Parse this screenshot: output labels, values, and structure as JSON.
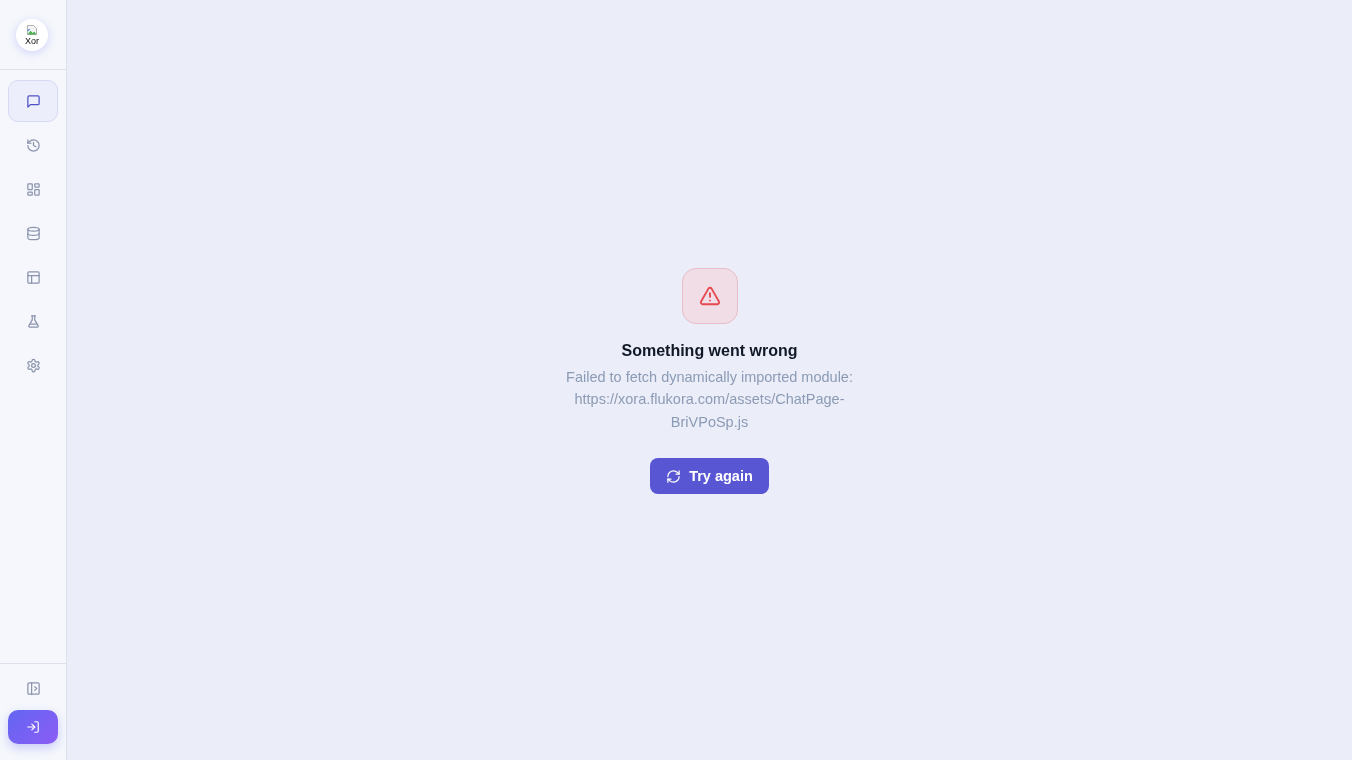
{
  "sidebar": {
    "logo": {
      "alt_text": "Xor"
    },
    "nav_items": [
      {
        "selected": true
      },
      {
        "selected": false
      },
      {
        "selected": false
      },
      {
        "selected": false
      },
      {
        "selected": false
      },
      {
        "selected": false
      },
      {
        "selected": false
      }
    ]
  },
  "error": {
    "title": "Something went wrong",
    "message": "Failed to fetch dynamically imported module: https://xora.flukora.com/assets/ChatPage-BriVPoSp.js",
    "button": "Try again"
  }
}
